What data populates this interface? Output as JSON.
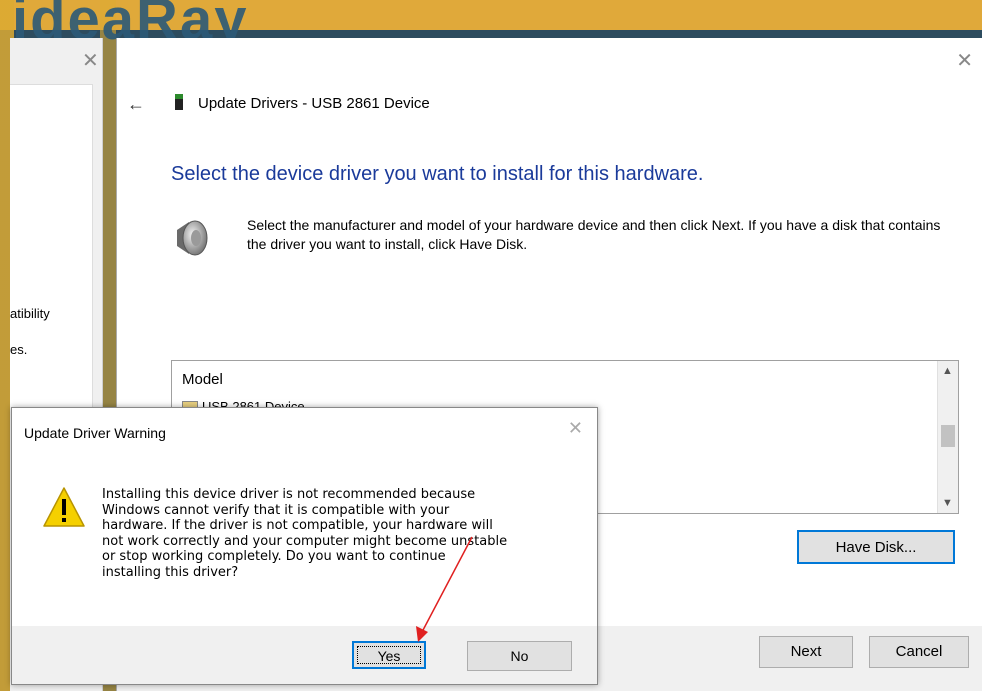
{
  "background": {
    "banner_text": "ideaRay",
    "left_window_text_1": "atibility",
    "left_window_text_2": "es."
  },
  "wizard": {
    "title": "Update Drivers - USB 2861 Device",
    "heading": "Select the device driver you want to install for this hardware.",
    "description": "Select the manufacturer and model of your hardware device and then click Next. If you have a disk that contains the driver you want to install, click Have Disk.",
    "model_header": "Model",
    "model_items": [
      "USB 2861 Device"
    ],
    "have_disk_label": "Have Disk...",
    "next_label": "Next",
    "cancel_label": "Cancel",
    "heading_color": "#1a3a9a"
  },
  "warning_dialog": {
    "title": "Update Driver Warning",
    "message": "Installing this device driver is not recommended because\nWindows cannot verify that it is compatible with your\nhardware.  If the driver is not compatible, your hardware will\nnot work correctly and your computer might become unstable\nor stop working completely.  Do you want to continue\ninstalling this driver?",
    "yes_label": "Yes",
    "no_label": "No",
    "icon": "warning-triangle-icon"
  },
  "annotation": {
    "color": "#e02020"
  }
}
